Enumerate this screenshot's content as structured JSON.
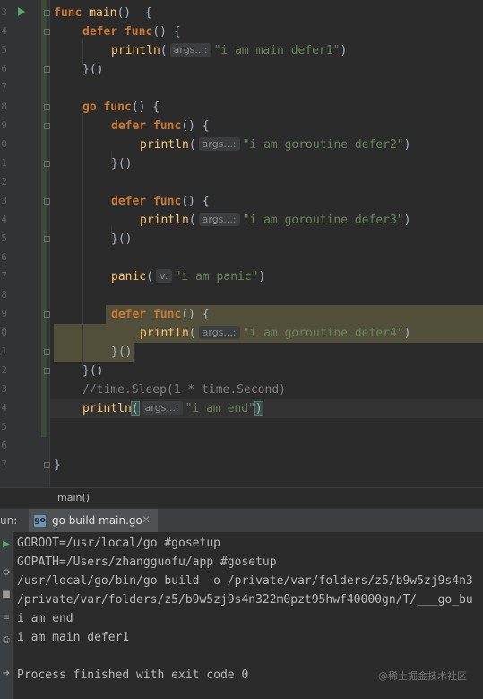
{
  "editor": {
    "line_numbers": [
      "3",
      "4",
      "5",
      "6",
      "7",
      "8",
      "9",
      "0",
      "1",
      "2",
      "3",
      "4",
      "5",
      "6",
      "7",
      "8",
      "9",
      "0",
      "1",
      "2",
      "3",
      "4",
      "5",
      "6",
      "7"
    ],
    "param_hints": {
      "args": "args...:",
      "v": "v:"
    },
    "lines": {
      "l1": {
        "kw": "func",
        "fn": "main",
        "rest": "()  {"
      },
      "l2": {
        "kw1": "defer",
        "kw2": "func",
        "rest": "() {"
      },
      "l3": {
        "fn": "println",
        "open": "(",
        "str": "\"i am main defer1\"",
        "close": ")"
      },
      "l4": {
        "text": "}()"
      },
      "l6": {
        "kw1": "go",
        "kw2": "func",
        "rest": "() {"
      },
      "l7": {
        "kw1": "defer",
        "kw2": "func",
        "rest": "() {"
      },
      "l8": {
        "fn": "println",
        "open": "(",
        "str": "\"i am goroutine defer2\"",
        "close": ")"
      },
      "l9": {
        "text": "}()"
      },
      "l11": {
        "kw1": "defer",
        "kw2": "func",
        "rest": "() {"
      },
      "l12": {
        "fn": "println",
        "open": "(",
        "str": "\"i am goroutine defer3\"",
        "close": ")"
      },
      "l13": {
        "text": "}()"
      },
      "l15": {
        "fn": "panic",
        "open": "(",
        "str": "\"i am panic\"",
        "close": ")"
      },
      "l17": {
        "kw1": "defer",
        "kw2": "func",
        "rest": "() {"
      },
      "l18": {
        "fn": "println",
        "open": "(",
        "str": "\"i am goroutine defer4\"",
        "close": ")"
      },
      "l19": {
        "text": "}()"
      },
      "l20": {
        "text": "}()"
      },
      "l21": {
        "comment": "//time.Sleep(1 * time.Second)"
      },
      "l22": {
        "fn": "println",
        "open": "(",
        "str": "\"i am end\"",
        "close": ")"
      },
      "l25": {
        "text": "}"
      }
    }
  },
  "breadcrumb": {
    "label": "main()"
  },
  "run_panel": {
    "label": "un:",
    "tab_label": "go build main.go",
    "tab_icon": "go-icon",
    "close_glyph": "✕"
  },
  "console": {
    "lines": [
      "GOROOT=/usr/local/go #gosetup",
      "GOPATH=/Users/zhangguofu/app #gosetup",
      "/usr/local/go/bin/go build -o /private/var/folders/z5/b9w5zj9s4n3",
      "/private/var/folders/z5/b9w5zj9s4n322m0pzt95hwf40000gn/T/___go_bu",
      "i am end",
      "i am main defer1",
      "",
      "Process finished with exit code 0"
    ],
    "watermark": "@稀土掘金技术社区"
  },
  "colors": {
    "keyword": "#cc7832",
    "function": "#ffc66d",
    "string": "#6a8759",
    "comment": "#808080",
    "highlight": "#52503a"
  }
}
